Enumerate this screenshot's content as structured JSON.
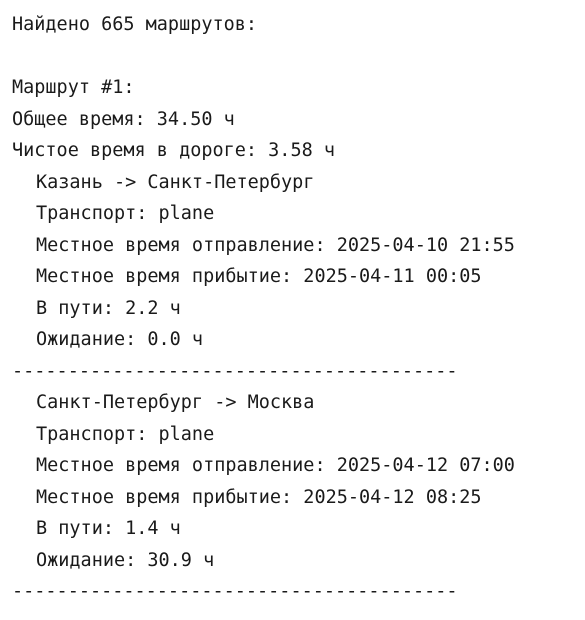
{
  "summary": "Найдено 665 маршрутов:",
  "route": {
    "title": "Маршрут #1:",
    "total_time": "Общее время: 34.50 ч",
    "road_time": "Чистое время в дороге: 3.58 ч"
  },
  "segments": [
    {
      "route": "Казань -> Санкт-Петербург",
      "transport": "Транспорт: plane",
      "departure": "Местное время отправление: 2025-04-10 21:55",
      "arrival": "Местное время прибытие: 2025-04-11 00:05",
      "travel": "В пути: 2.2 ч",
      "waiting": "Ожидание: 0.0 ч"
    },
    {
      "route": "Санкт-Петербург -> Москва",
      "transport": "Транспорт: plane",
      "departure": "Местное время отправление: 2025-04-12 07:00",
      "arrival": "Местное время прибытие: 2025-04-12 08:25",
      "travel": "В пути: 1.4 ч",
      "waiting": "Ожидание: 30.9 ч"
    }
  ],
  "separator": "----------------------------------------"
}
